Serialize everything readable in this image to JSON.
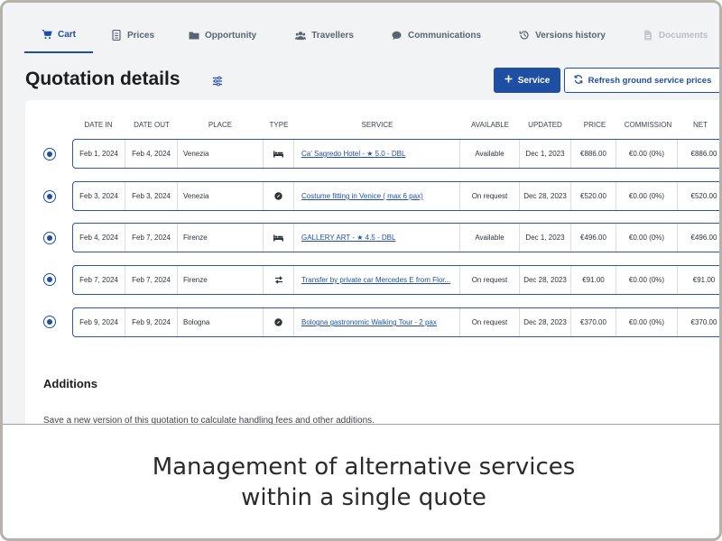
{
  "tabs": [
    {
      "label": "Cart",
      "icon": "cart-icon",
      "state": "active"
    },
    {
      "label": "Prices",
      "icon": "document-icon",
      "state": "normal"
    },
    {
      "label": "Opportunity",
      "icon": "folder-icon",
      "state": "normal"
    },
    {
      "label": "Travellers",
      "icon": "users-icon",
      "state": "normal"
    },
    {
      "label": "Communications",
      "icon": "chat-icon",
      "state": "normal"
    },
    {
      "label": "Versions history",
      "icon": "history-icon",
      "state": "normal"
    },
    {
      "label": "Documents",
      "icon": "file-icon",
      "state": "disabled"
    }
  ],
  "page": {
    "title": "Quotation details",
    "filter_icon": "sliders-icon",
    "service_button": "Service",
    "refresh_button": "Refresh ground service prices"
  },
  "table": {
    "headers": [
      "DATE IN",
      "DATE OUT",
      "PLACE",
      "TYPE",
      "SERVICE",
      "AVAILABLE",
      "UPDATED",
      "PRICE",
      "COMMISSION",
      "NET"
    ],
    "rows": [
      {
        "date_in": "Feb 1, 2024",
        "date_out": "Feb 4, 2024",
        "place": "Venezia",
        "type_icon": "bed-icon",
        "service": "Ca' Sagredo Hotel - ★ 5.0 - DBL",
        "available": "Available",
        "updated": "Dec 1, 2023",
        "price": "€886.00",
        "commission": "€0.00 (0%)",
        "net": "€886.00",
        "selected": true
      },
      {
        "date_in": "Feb 3, 2024",
        "date_out": "Feb 3, 2024",
        "place": "Venezia",
        "type_icon": "compass-icon",
        "service": "Costume fitting in Venice ( max 6 pax)",
        "available": "On request",
        "updated": "Dec 28, 2023",
        "price": "€520.00",
        "commission": "€0.00 (0%)",
        "net": "€520.00",
        "selected": true
      },
      {
        "date_in": "Feb 4, 2024",
        "date_out": "Feb 7, 2024",
        "place": "Firenze",
        "type_icon": "bed-icon",
        "service": "GALLERY ART - ★ 4.5 - DBL",
        "available": "Available",
        "updated": "Dec 1, 2023",
        "price": "€496.00",
        "commission": "€0.00 (0%)",
        "net": "€496.00",
        "selected": true
      },
      {
        "date_in": "Feb 7, 2024",
        "date_out": "Feb 7, 2024",
        "place": "Firenze",
        "type_icon": "transfer-icon",
        "service": "Transfer by private car Mercedes E from Flor...",
        "available": "On request",
        "updated": "Dec 28, 2023",
        "price": "€91.00",
        "commission": "€0.00 (0%)",
        "net": "€91.00",
        "selected": true
      },
      {
        "date_in": "Feb 9, 2024",
        "date_out": "Feb 9, 2024",
        "place": "Bologna",
        "type_icon": "compass-icon",
        "service": "Bologna gastronomic Walking Tour - 2 pax",
        "available": "On request",
        "updated": "Dec 28, 2023",
        "price": "€370.00",
        "commission": "€0.00 (0%)",
        "net": "€370.00",
        "selected": true
      }
    ]
  },
  "additions": {
    "title": "Additions",
    "note": "Save a new version of this quotation to calculate handling fees and other additions."
  },
  "caption": {
    "line1": "Management of alternative services",
    "line2": "within a single quote"
  },
  "colors": {
    "accent": "#1f4fa3",
    "background": "#f2f3f5"
  }
}
